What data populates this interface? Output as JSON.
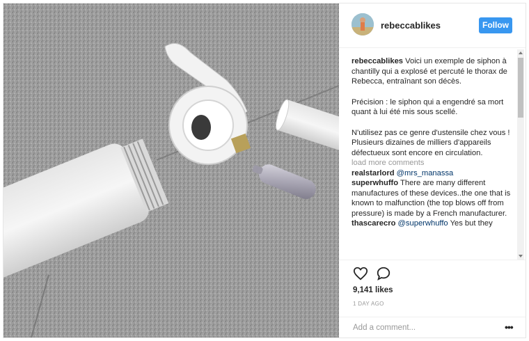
{
  "post": {
    "username": "rebeccablikes",
    "follow_label": "Follow",
    "caption": {
      "username": "rebeccablikes",
      "para1": "Voici un exemple de siphon à chantilly qui a explosé et percuté le thorax de Rebecca, entraînant son décès.",
      "para2": "Précision : le siphon qui a engendré sa mort quant à lui été mis sous scellé.",
      "para3": "N'utilisez pas ce genre d'ustensile chez vous ! Plusieurs dizaines de milliers d'appareils défectueux sont encore en circulation."
    },
    "load_more": "load more comments",
    "comments": [
      {
        "user": "realstarlord",
        "mention": "@mrs_manassa",
        "text": ""
      },
      {
        "user": "superwhuffo",
        "mention": "",
        "text": "There are many different manufactures of these devices..the one that is known to malfunction (the top blows off from pressure) is made by a French manufacturer."
      },
      {
        "user": "thascarecro",
        "mention": "@superwhuffo",
        "text": "Yes but they"
      }
    ],
    "likes": "9,141 likes",
    "time": "1 DAY AGO",
    "add_comment_placeholder": "Add a comment...",
    "more_label": "•••",
    "icons": [
      "heart-icon",
      "comment-icon",
      "more-options-icon"
    ],
    "colors": {
      "follow": "#3897f0",
      "mention": "#003569",
      "muted": "#999999"
    }
  }
}
